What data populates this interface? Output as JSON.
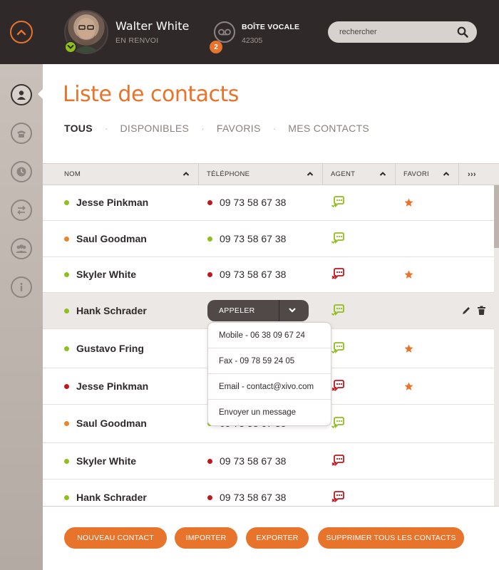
{
  "header": {
    "user": {
      "name": "Walter White",
      "status": "EN RENVOI"
    },
    "voicemail": {
      "title": "BOÎTE VOCALE",
      "number": "42305",
      "badge_count": "2"
    },
    "search": {
      "placeholder": "rechercher"
    }
  },
  "sidebar": {
    "items": [
      {
        "icon": "user-icon",
        "active": true
      },
      {
        "icon": "phone-icon",
        "active": false
      },
      {
        "icon": "clock-icon",
        "active": false
      },
      {
        "icon": "transfer-icon",
        "active": false
      },
      {
        "icon": "group-icon",
        "active": false
      },
      {
        "icon": "info-icon",
        "active": false
      }
    ]
  },
  "page": {
    "title": "Liste de contacts",
    "tabs": [
      {
        "label": "TOUS",
        "active": true
      },
      {
        "label": "DISPONIBLES",
        "active": false
      },
      {
        "label": "FAVORIS",
        "active": false
      },
      {
        "label": "MES CONTACTS",
        "active": false
      }
    ]
  },
  "table": {
    "columns": [
      "NOM",
      "TÉLÉPHONE",
      "AGENT",
      "FAVORI",
      "›››"
    ],
    "rows": [
      {
        "name": "Jesse Pinkman",
        "presence": "#8fbf1c",
        "phone": "09 73 58 67 38",
        "phone_status": "#c0171f",
        "agent": "available",
        "favorite": true
      },
      {
        "name": "Saul Goodman",
        "presence": "#e8862a",
        "phone": "09 73 58 67 38",
        "phone_status": "#8fbf1c",
        "agent": "available",
        "favorite": false
      },
      {
        "name": "Skyler White",
        "presence": "#8fbf1c",
        "phone": "09 73 58 67 38",
        "phone_status": "#c0171f",
        "agent": "unavailable",
        "favorite": true
      },
      {
        "name": "Hank Schrader",
        "presence": "#8fbf1c",
        "phone": "",
        "phone_status": "",
        "agent": "available",
        "favorite": false
      },
      {
        "name": "Gustavo Fring",
        "presence": "#8fbf1c",
        "phone": "",
        "phone_status": "",
        "agent": "available",
        "favorite": true
      },
      {
        "name": "Jesse Pinkman",
        "presence": "#c0171f",
        "phone": "",
        "phone_status": "",
        "agent": "unavailable",
        "favorite": true
      },
      {
        "name": "Saul Goodman",
        "presence": "#e8862a",
        "phone": "09 73 58 67 38",
        "phone_status": "#8fbf1c",
        "agent": "available",
        "favorite": false
      },
      {
        "name": "Skyler White",
        "presence": "#8fbf1c",
        "phone": "09 73 58 67 38",
        "phone_status": "#c0171f",
        "agent": "unavailable",
        "favorite": false
      },
      {
        "name": "Hank Schrader",
        "presence": "#8fbf1c",
        "phone": "09 73 58 67 38",
        "phone_status": "#c0171f",
        "agent": "unavailable",
        "favorite": false
      }
    ]
  },
  "call_menu": {
    "button_label": "APPELER",
    "options": [
      "Mobile - 06 38 09 67 24",
      "Fax - 09 78 59 24 05",
      "Email - contact@xivo.com",
      "Envoyer un message"
    ]
  },
  "footer": {
    "buttons": [
      "NOUVEAU CONTACT",
      "IMPORTER",
      "EXPORTER",
      "SUPPRIMER TOUS LES CONTACTS"
    ]
  },
  "colors": {
    "accent": "#e8732a",
    "header_bg": "#2f2a29",
    "available": "#8fbf1c",
    "unavailable": "#c0171f"
  }
}
